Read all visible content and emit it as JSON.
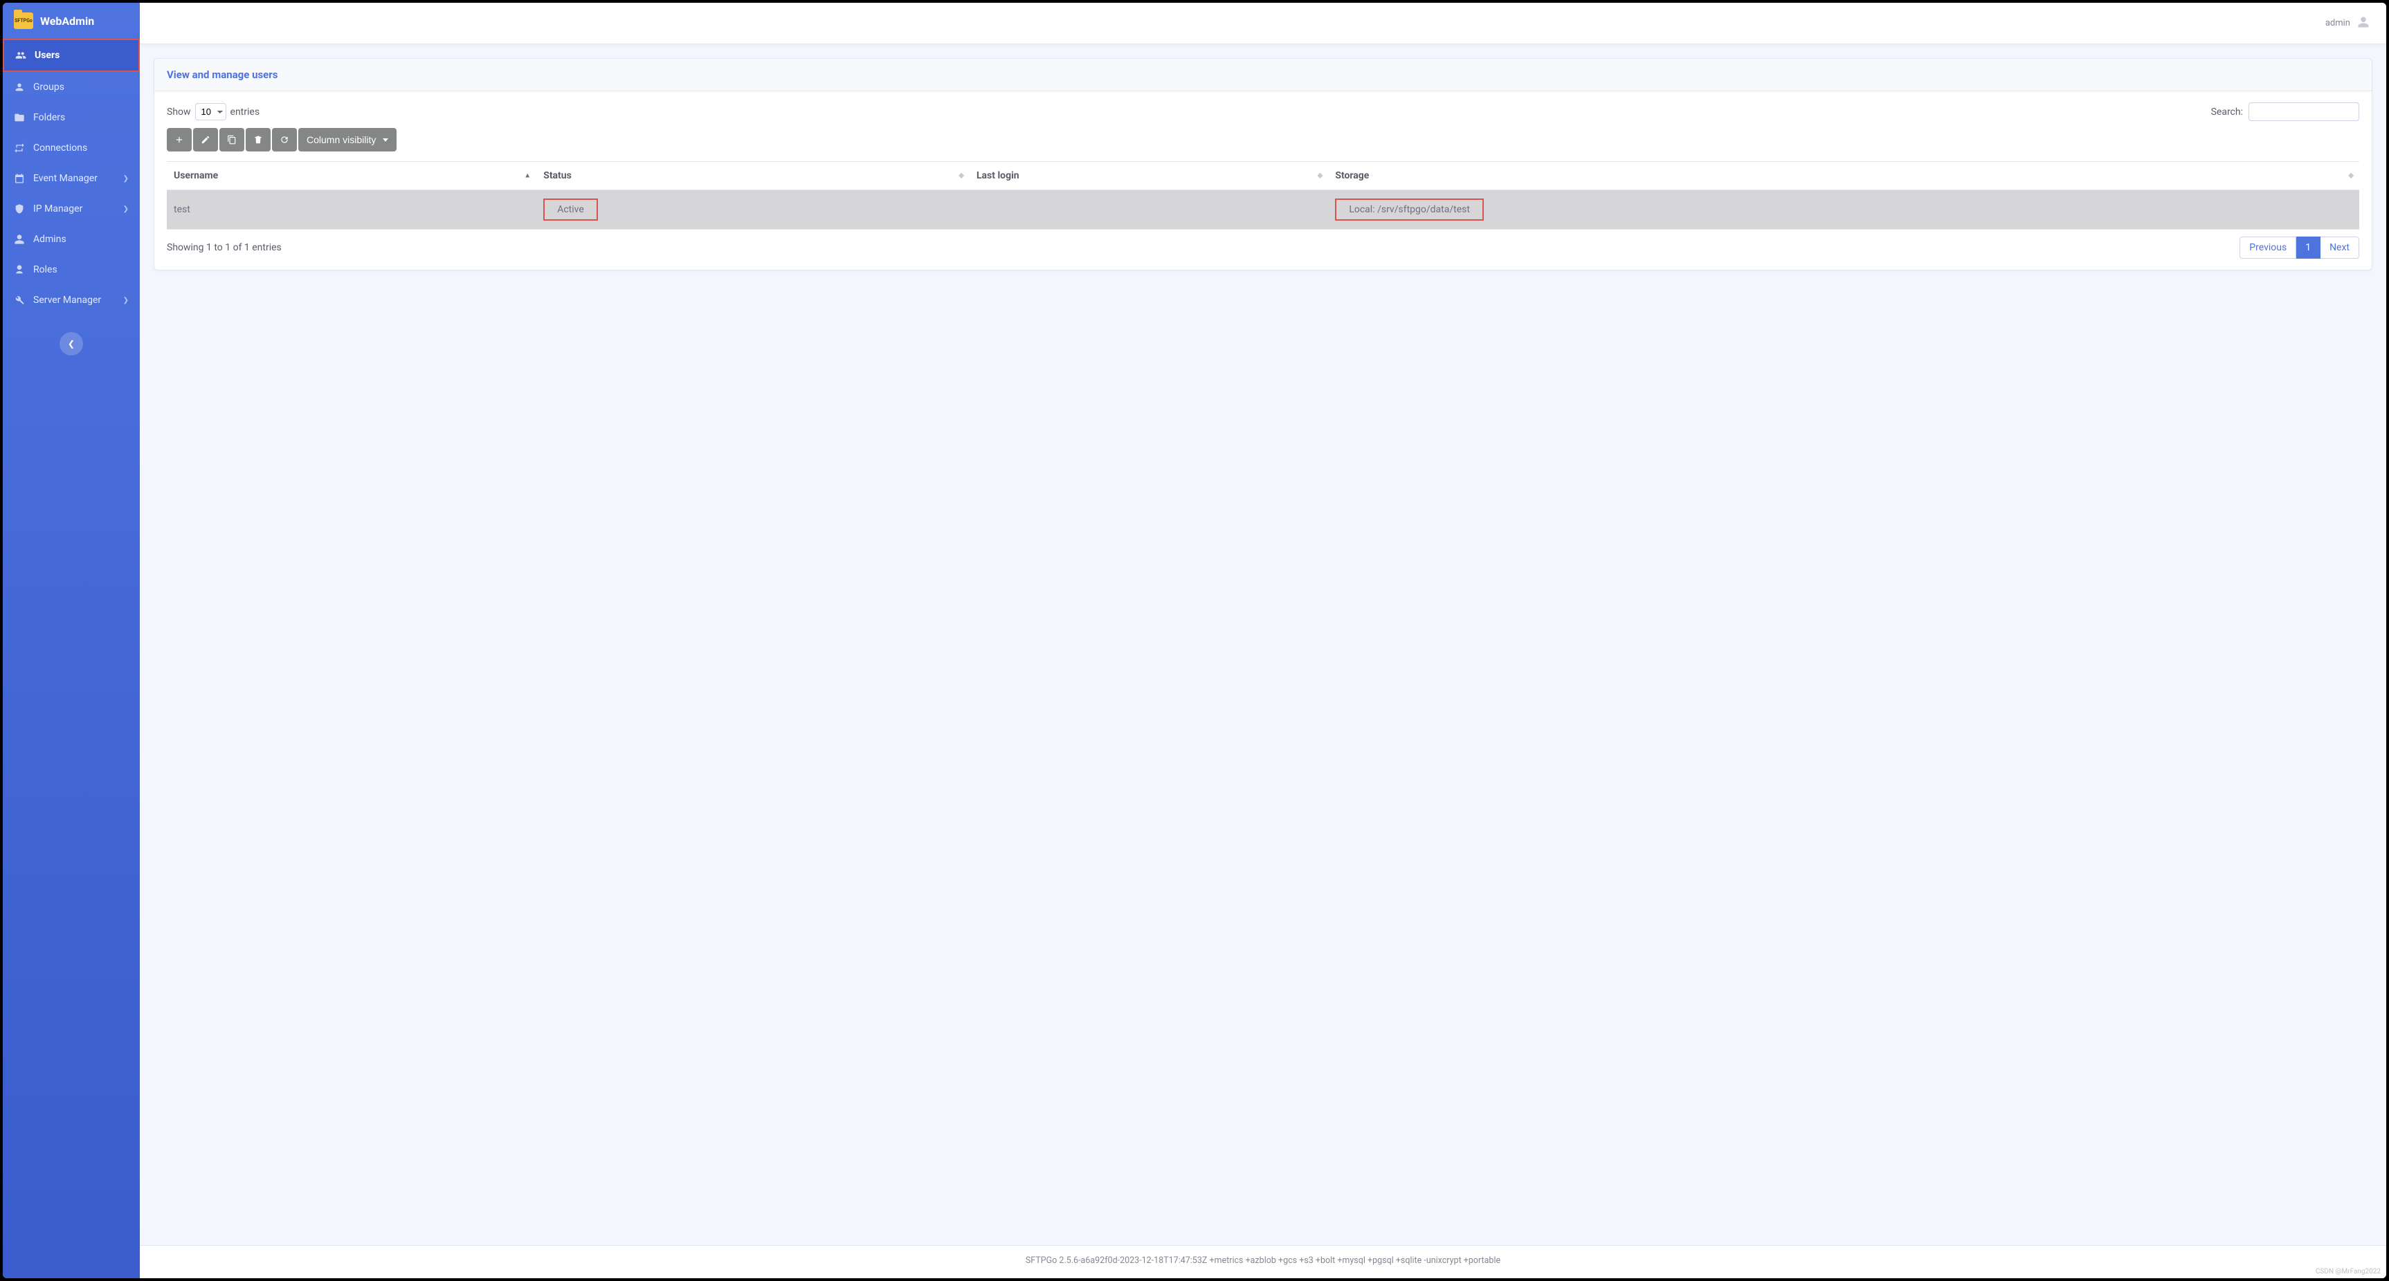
{
  "brand": {
    "logo_text": "SFTPGo",
    "title": "WebAdmin"
  },
  "sidebar": {
    "items": [
      {
        "icon": "users",
        "label": "Users",
        "active": true,
        "submenu": false
      },
      {
        "icon": "group",
        "label": "Groups",
        "active": false,
        "submenu": false
      },
      {
        "icon": "folder",
        "label": "Folders",
        "active": false,
        "submenu": false
      },
      {
        "icon": "exchange",
        "label": "Connections",
        "active": false,
        "submenu": false
      },
      {
        "icon": "calendar",
        "label": "Event Manager",
        "active": false,
        "submenu": true
      },
      {
        "icon": "shield",
        "label": "IP Manager",
        "active": false,
        "submenu": true
      },
      {
        "icon": "admin",
        "label": "Admins",
        "active": false,
        "submenu": false
      },
      {
        "icon": "roles",
        "label": "Roles",
        "active": false,
        "submenu": false
      },
      {
        "icon": "wrench",
        "label": "Server Manager",
        "active": false,
        "submenu": true
      }
    ]
  },
  "topbar": {
    "username": "admin"
  },
  "card": {
    "title": "View and manage users"
  },
  "entries": {
    "show_label_pre": "Show",
    "show_label_post": "entries",
    "selected": "10"
  },
  "search": {
    "label": "Search:",
    "value": ""
  },
  "toolbar": {
    "add": "Add",
    "edit": "Edit",
    "clone": "Clone",
    "delete": "Delete",
    "refresh": "Refresh",
    "colvis_label": "Column visibility"
  },
  "table": {
    "columns": [
      "Username",
      "Status",
      "Last login",
      "Storage"
    ],
    "sort_col": 0,
    "sort_dir": "asc",
    "rows": [
      {
        "username": "test",
        "status": "Active",
        "last_login": "",
        "storage": "Local: /srv/sftpgo/data/test",
        "selected": true
      }
    ]
  },
  "showing": "Showing 1 to 1 of 1 entries",
  "pagination": {
    "prev": "Previous",
    "next": "Next",
    "pages": [
      "1"
    ],
    "active": "1"
  },
  "footer": "SFTPGo 2.5.6-a6a92f0d-2023-12-18T17:47:53Z +metrics +azblob +gcs +s3 +bolt +mysql +pgsql +sqlite -unixcrypt +portable",
  "watermark": "CSDN @MrFang2022"
}
